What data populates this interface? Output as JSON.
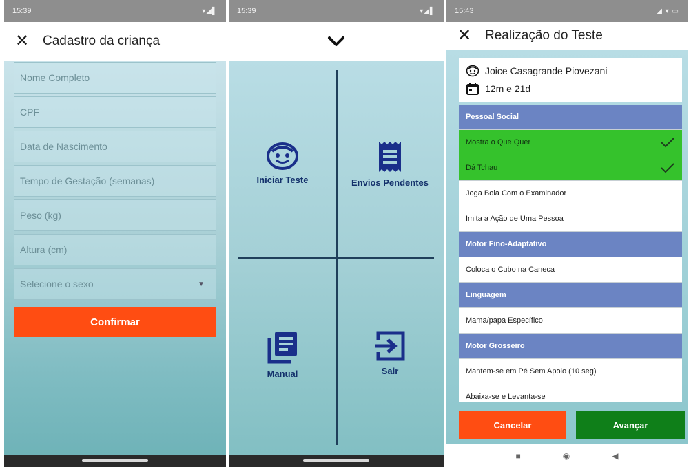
{
  "screen1": {
    "status": {
      "time": "15:39",
      "signal": "▾◢▌"
    },
    "title": "Cadastro da criança",
    "fields": [
      {
        "placeholder": "Nome Completo"
      },
      {
        "placeholder": "CPF"
      },
      {
        "placeholder": "Data de Nascimento"
      },
      {
        "placeholder": "Tempo de Gestação (semanas)"
      },
      {
        "placeholder": "Peso (kg)"
      },
      {
        "placeholder": "Altura (cm)"
      },
      {
        "placeholder": "Selecione o sexo"
      }
    ],
    "confirm_label": "Confirmar"
  },
  "screen2": {
    "status": {
      "time": "15:39",
      "signal": "▾◢▌"
    },
    "tiles": [
      {
        "label": "Iniciar Teste",
        "icon": "face-icon"
      },
      {
        "label": "Envios Pendentes",
        "icon": "receipt-icon"
      },
      {
        "label": "Manual",
        "icon": "library-books-icon"
      },
      {
        "label": "Sair",
        "icon": "exit-icon"
      }
    ]
  },
  "screen3": {
    "status": {
      "time": "15:43",
      "signal": "◢ ▾ ▭"
    },
    "title": "Realização do Teste",
    "child_name": "Joice Casagrande Piovezani",
    "child_age": "12m e 21d",
    "rows": [
      {
        "label": "Pessoal Social",
        "type": "category"
      },
      {
        "label": "Mostra o Que Quer",
        "type": "done"
      },
      {
        "label": "Dá Tchau",
        "type": "done"
      },
      {
        "label": "Joga Bola Com o Examinador",
        "type": "item"
      },
      {
        "label": "Imita a Ação de Uma Pessoa",
        "type": "item"
      },
      {
        "label": "Motor Fino-Adaptativo",
        "type": "category"
      },
      {
        "label": "Coloca o Cubo na Caneca",
        "type": "item"
      },
      {
        "label": "Linguagem",
        "type": "category"
      },
      {
        "label": "Mama/papa Específico",
        "type": "item"
      },
      {
        "label": "Motor Grosseiro",
        "type": "category"
      },
      {
        "label": "Mantem-se em Pé Sem Apoio (10 seg)",
        "type": "item"
      },
      {
        "label": "Abaixa-se e Levanta-se",
        "type": "item"
      }
    ],
    "cancel_label": "Cancelar",
    "next_label": "Avançar",
    "colors": {
      "category": "#6b84c3",
      "done": "#35c22c",
      "cancel": "#ff4d12",
      "next": "#0f7f19"
    }
  }
}
